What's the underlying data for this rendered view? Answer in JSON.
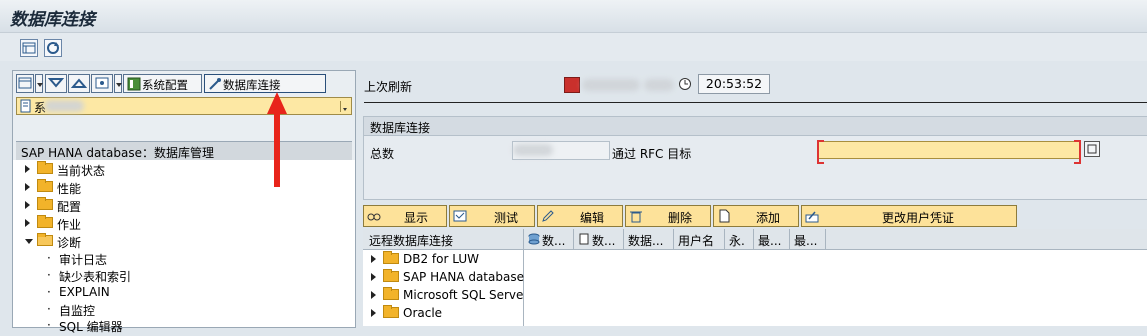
{
  "title": "数据库连接",
  "left_toolbar": {
    "system_config": "系统配置",
    "db_connection": "数据库连接"
  },
  "left_select": {
    "value_prefix": "系"
  },
  "tree": {
    "header": "SAP HANA database：数据库管理",
    "items": [
      {
        "label": "当前状态",
        "expanded": false
      },
      {
        "label": "性能",
        "expanded": false
      },
      {
        "label": "配置",
        "expanded": false
      },
      {
        "label": "作业",
        "expanded": false
      },
      {
        "label": "诊断",
        "expanded": true
      }
    ],
    "children": [
      "审计日志",
      "缺少表和索引",
      "EXPLAIN",
      "自监控",
      "SQL 编辑器"
    ]
  },
  "info": {
    "last_refresh_label": "上次刷新",
    "last_refresh_time": "20:53:52"
  },
  "group": {
    "title": "数据库连接",
    "total_label": "总数",
    "rfc_label": "通过 RFC 目标",
    "rfc_value": ""
  },
  "actions": {
    "display": "显示",
    "test": "测试",
    "edit": "编辑",
    "delete": "删除",
    "add": "添加",
    "change_credentials": "更改用户凭证"
  },
  "remote_tree": {
    "header": "远程数据库连接",
    "items": [
      "DB2 for LUW",
      "SAP HANA database",
      "Microsoft SQL Server",
      "Oracle"
    ]
  },
  "columns": [
    "数...",
    "数...",
    "数据...",
    "用户名",
    "永.",
    "最...",
    "最..."
  ],
  "colors": {
    "input_yellow": "#fde8a4",
    "button_yellow": "#fde29a",
    "arrow_red": "#e8241a",
    "folder": "#f2b32a"
  }
}
